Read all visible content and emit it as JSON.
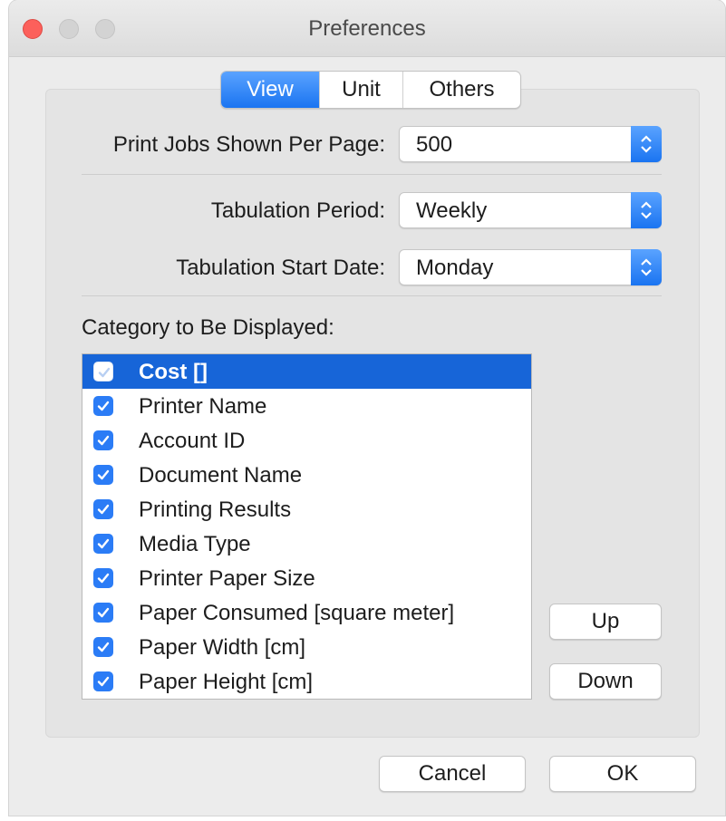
{
  "window": {
    "title": "Preferences"
  },
  "tabs": [
    {
      "label": "View",
      "active": true
    },
    {
      "label": "Unit",
      "active": false
    },
    {
      "label": "Others",
      "active": false
    }
  ],
  "settings": {
    "jobs_per_page": {
      "label": "Print Jobs Shown Per Page:",
      "value": "500"
    },
    "tabulation_period": {
      "label": "Tabulation Period:",
      "value": "Weekly"
    },
    "tabulation_start": {
      "label": "Tabulation Start Date:",
      "value": "Monday"
    }
  },
  "categories": {
    "label": "Category to Be Displayed:",
    "items": [
      {
        "label": "Cost []",
        "checked": true,
        "selected": true
      },
      {
        "label": "Printer Name",
        "checked": true,
        "selected": false
      },
      {
        "label": "Account ID",
        "checked": true,
        "selected": false
      },
      {
        "label": "Document Name",
        "checked": true,
        "selected": false
      },
      {
        "label": "Printing Results",
        "checked": true,
        "selected": false
      },
      {
        "label": "Media Type",
        "checked": true,
        "selected": false
      },
      {
        "label": "Printer Paper Size",
        "checked": true,
        "selected": false
      },
      {
        "label": "Paper Consumed [square meter]",
        "checked": true,
        "selected": false
      },
      {
        "label": "Paper Width [cm]",
        "checked": true,
        "selected": false
      },
      {
        "label": "Paper Height [cm]",
        "checked": true,
        "selected": false
      }
    ]
  },
  "buttons": {
    "up": "Up",
    "down": "Down",
    "cancel": "Cancel",
    "ok": "OK"
  },
  "colors": {
    "accent": "#1a74f1",
    "selection": "#1765d8",
    "close_button": "#fc605b"
  }
}
